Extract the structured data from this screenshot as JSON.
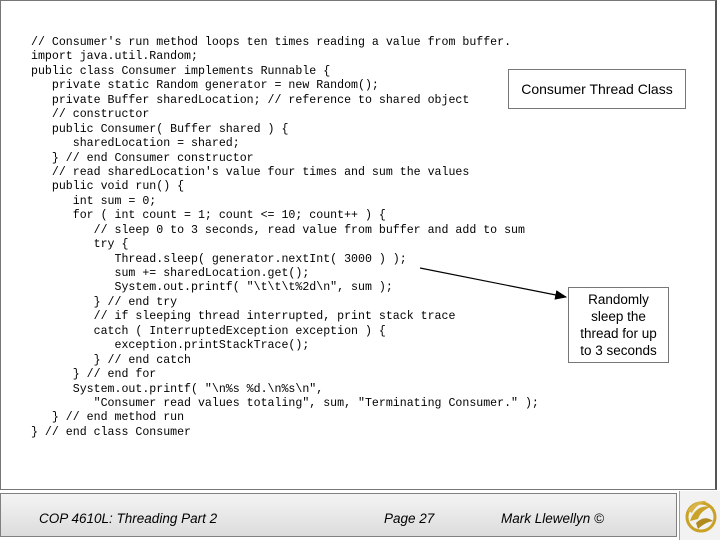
{
  "code_lines": [
    "// Consumer's run method loops ten times reading a value from buffer.",
    "import java.util.Random;",
    "public class Consumer implements Runnable {",
    "   private static Random generator = new Random();",
    "   private Buffer sharedLocation; // reference to shared object",
    "   // constructor",
    "   public Consumer( Buffer shared ) {",
    "      sharedLocation = shared;",
    "   } // end Consumer constructor",
    "   // read sharedLocation's value four times and sum the values",
    "   public void run() {",
    "      int sum = 0;",
    "      for ( int count = 1; count <= 10; count++ ) {",
    "         // sleep 0 to 3 seconds, read value from buffer and add to sum",
    "         try {",
    "            Thread.sleep( generator.nextInt( 3000 ) );",
    "            sum += sharedLocation.get();",
    "            System.out.printf( \"\\t\\t\\t%2d\\n\", sum );",
    "         } // end try",
    "         // if sleeping thread interrupted, print stack trace",
    "         catch ( InterruptedException exception ) {",
    "            exception.printStackTrace();",
    "         } // end catch",
    "      } // end for",
    "      System.out.printf( \"\\n%s %d.\\n%s\\n\",",
    "         \"Consumer read values totaling\", sum, \"Terminating Consumer.\" );",
    "   } // end method run",
    "} // end class Consumer"
  ],
  "callout_title": "Consumer Thread Class",
  "callout_note": [
    "Randomly",
    "sleep the",
    "thread for up",
    "to 3 seconds"
  ],
  "footer": {
    "course": "COP 4610L: Threading Part 2",
    "page": "Page 27",
    "author": "Mark Llewellyn ©"
  },
  "colors": {
    "text": "#000000",
    "border": "#777777",
    "footer_bg": "#e6e6e6",
    "logo_gold": "#c9a227"
  },
  "logo_icon": "ucf-pegasus-logo-icon"
}
